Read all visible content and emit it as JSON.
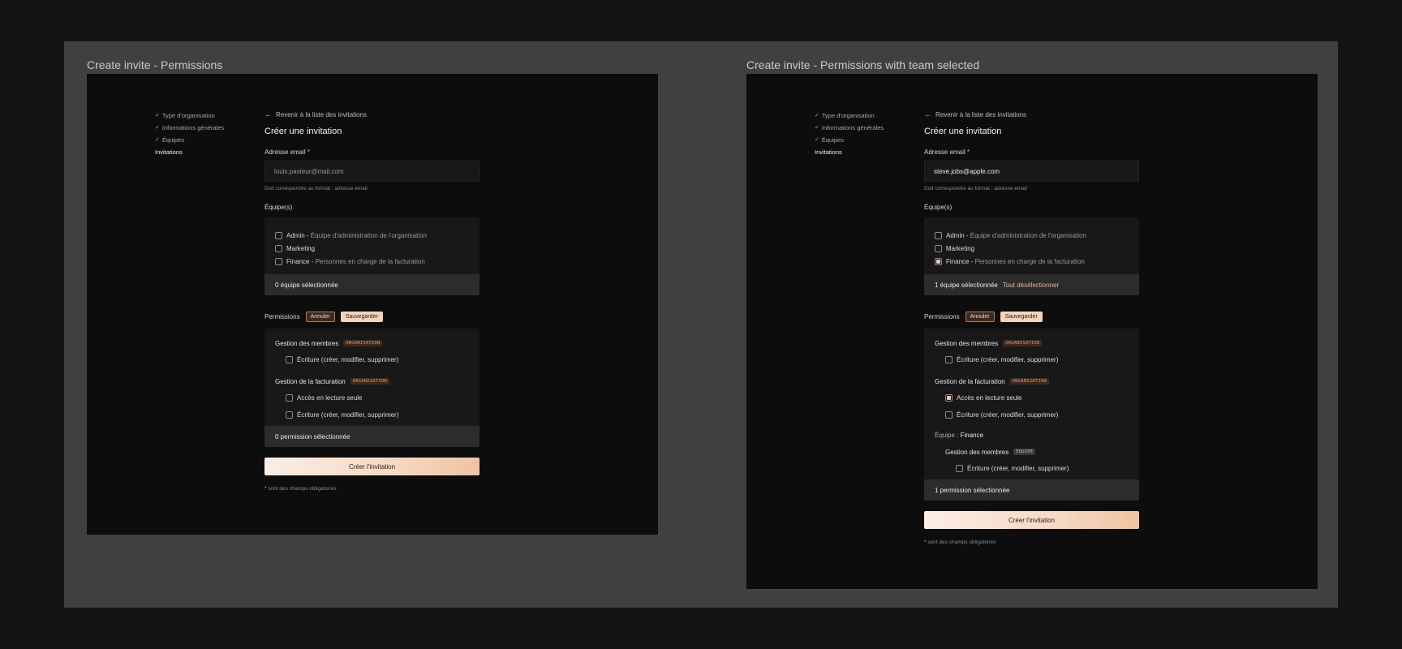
{
  "frames": [
    {
      "title": "Create invite - Permissions",
      "steps": [
        {
          "label": "Type d'organisation",
          "done": true
        },
        {
          "label": "Informations générales",
          "done": true
        },
        {
          "label": "Équipes",
          "done": true
        },
        {
          "label": "Invitations",
          "done": false
        }
      ],
      "back_label": "Revenir à la liste des invitations",
      "form_title": "Créer une invitation",
      "email_label": "Adresse email",
      "required_mark": "*",
      "email_value": "louis.pasteur@mail.com",
      "email_hint": "Doit correspondre au format : adresse email",
      "teams_label": "Équipe(s)",
      "teams": [
        {
          "name": "Admin",
          "sep": " - ",
          "desc": "Équipe d'administration de l'organisation",
          "checked": false
        },
        {
          "name": "Marketing",
          "sep": "",
          "desc": "",
          "checked": false
        },
        {
          "name": "Finance",
          "sep": " - ",
          "desc": "Personnes en charge de la facturation",
          "checked": false
        }
      ],
      "teams_footer": "0 équipe sélectionnée",
      "teams_footer_link": "",
      "permissions_label": "Permissions",
      "cancel_label": "Annuler",
      "save_label": "Sauvegarder",
      "perm_groups": [
        {
          "title": "Gestion des membres",
          "tag": "ORGANISATION",
          "items": [
            {
              "label": "Écriture (créer, modifier, supprimer)",
              "checked": false
            }
          ]
        },
        {
          "title": "Gestion de la facturation",
          "tag": "ORGANISATION",
          "items": [
            {
              "label": "Accès en lecture seule",
              "checked": false
            },
            {
              "label": "Écriture (créer, modifier, supprimer)",
              "checked": false
            }
          ]
        }
      ],
      "perm_footer": "0 permission sélectionnée",
      "create_label": "Créer l'invitation",
      "footnote_mark": "*",
      "footnote_text": " sont des champs obligatoires"
    },
    {
      "title": "Create invite - Permissions with team selected",
      "steps": [
        {
          "label": "Type d'organisation",
          "done": true
        },
        {
          "label": "Informations générales",
          "done": true
        },
        {
          "label": "Équipes",
          "done": true
        },
        {
          "label": "Invitations",
          "done": false
        }
      ],
      "back_label": "Revenir à la liste des invitations",
      "form_title": "Créer une invitation",
      "email_label": "Adresse email",
      "required_mark": "*",
      "email_value": "steve.jobs@apple.com",
      "email_hint": "Doit correspondre au format : adresse email",
      "teams_label": "Équipe(s)",
      "teams": [
        {
          "name": "Admin",
          "sep": " - ",
          "desc": "Équipe d'administration de l'organisation",
          "checked": false
        },
        {
          "name": "Marketing",
          "sep": "",
          "desc": "",
          "checked": false
        },
        {
          "name": "Finance",
          "sep": " - ",
          "desc": "Personnes en charge de la facturation",
          "checked": true
        }
      ],
      "teams_footer": "1 équipe sélectionnée",
      "teams_footer_link": "Tout désélectionner",
      "permissions_label": "Permissions",
      "cancel_label": "Annuler",
      "save_label": "Sauvegarder",
      "perm_groups": [
        {
          "title": "Gestion des membres",
          "tag": "ORGANISATION",
          "items": [
            {
              "label": "Écriture (créer, modifier, supprimer)",
              "checked": false
            }
          ]
        },
        {
          "title": "Gestion de la facturation",
          "tag": "ORGANISATION",
          "items": [
            {
              "label": "Accès en lecture seule",
              "checked": true
            },
            {
              "label": "Écriture (créer, modifier, supprimer)",
              "checked": false
            }
          ]
        }
      ],
      "team_section_prefix": "Équipe : ",
      "team_section_name": "Finance",
      "team_perm_group": {
        "title": "Gestion des membres",
        "tag": "ÉQUIPE",
        "items": [
          {
            "label": "Écriture (créer, modifier, supprimer)",
            "checked": false
          }
        ]
      },
      "perm_footer": "1 permission sélectionnée",
      "create_label": "Créer l'invitation",
      "footnote_mark": "*",
      "footnote_text": " sont des champs obligatoires"
    }
  ],
  "colors": {
    "accent": "#f0a37c",
    "background": "#141414",
    "canvas": "#404040",
    "frame": "#0d0d0d"
  }
}
